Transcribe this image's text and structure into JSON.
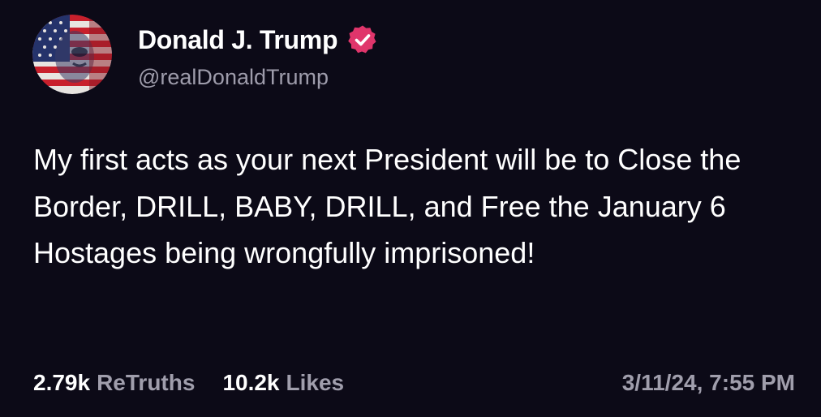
{
  "post": {
    "author": {
      "display_name": "Donald J. Trump",
      "handle": "@realDonaldTrump",
      "verified_icon": "verified-badge-icon",
      "verified_color": "#e0356b"
    },
    "text": "My first acts as your next President will be to Close the Border, DRILL, BABY, DRILL, and Free the January 6 Hostages being wrongfully imprisoned!",
    "stats": {
      "retruths_count": "2.79k",
      "retruths_label": "ReTruths",
      "likes_count": "10.2k",
      "likes_label": "Likes"
    },
    "timestamp": "3/11/24, 7:55 PM"
  },
  "theme": {
    "background": "#0c0a17",
    "text": "#ffffff",
    "muted": "#a09eac"
  }
}
